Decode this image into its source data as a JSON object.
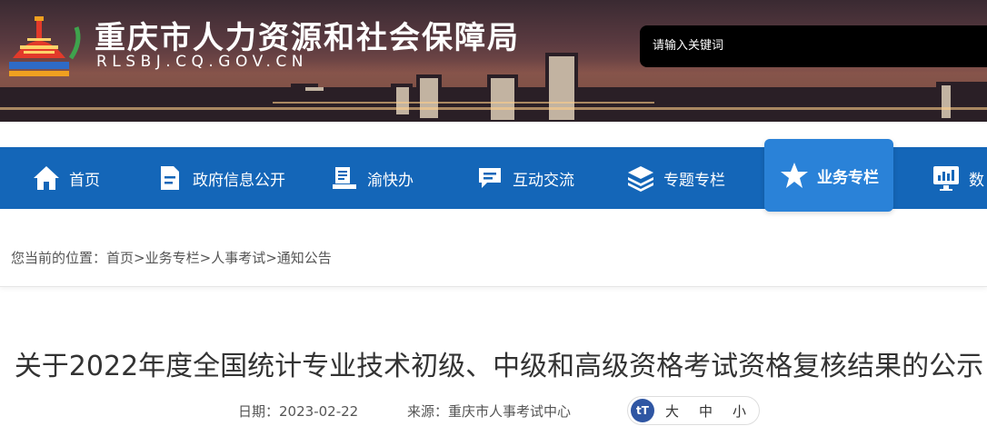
{
  "header": {
    "site_title": "重庆市人力资源和社会保障局",
    "site_domain": "RLSBJ.CQ.GOV.CN",
    "search_placeholder": "请输入关键词"
  },
  "nav": {
    "items": [
      {
        "label": "首页",
        "icon": "home-icon"
      },
      {
        "label": "政府信息公开",
        "icon": "document-icon"
      },
      {
        "label": "渝快办",
        "icon": "book-icon"
      },
      {
        "label": "互动交流",
        "icon": "chat-icon"
      },
      {
        "label": "专题专栏",
        "icon": "layers-icon"
      },
      {
        "label": "业务专栏",
        "icon": "star-icon",
        "active": true
      },
      {
        "label": "数",
        "icon": "monitor-icon"
      }
    ]
  },
  "breadcrumb": {
    "prefix": "您当前的位置：",
    "items": [
      "首页",
      "业务专栏",
      "人事考试",
      "通知公告"
    ],
    "separator": ">"
  },
  "article": {
    "title": "关于2022年度全国统计专业技术初级、中级和高级资格考试资格复核结果的公示",
    "date_label": "日期：",
    "date": "2023-02-22",
    "source_label": "来源：",
    "source": "重庆市人事考试中心",
    "font_sizes": [
      "大",
      "中",
      "小"
    ],
    "font_icon_text": "tT"
  },
  "colors": {
    "nav_bg": "#1466b8",
    "nav_active_bg": "#2a82d8",
    "font_icon_bg": "#2f56a3"
  }
}
